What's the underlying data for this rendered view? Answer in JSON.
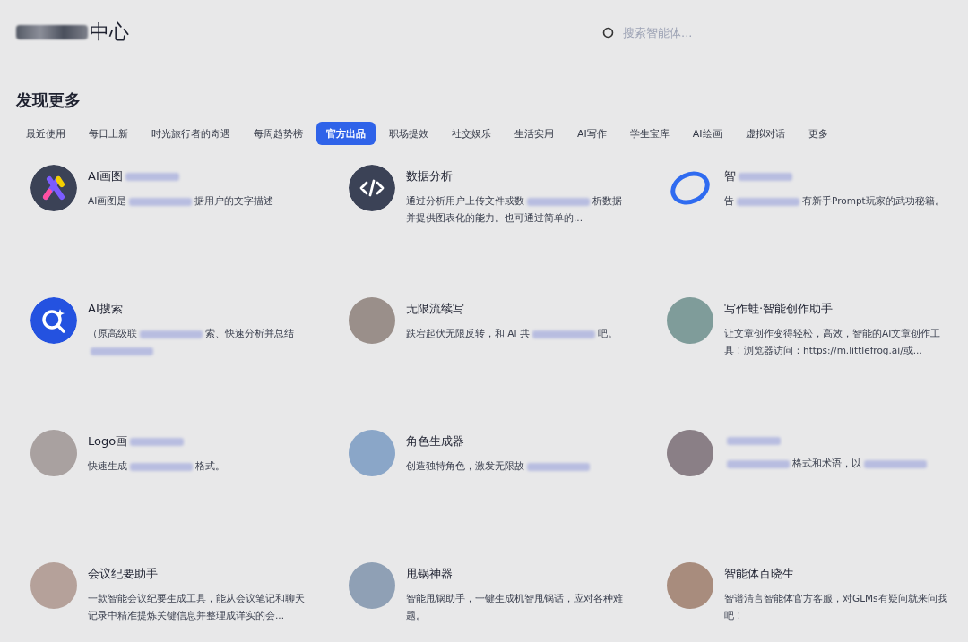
{
  "header": {
    "logo_suffix": "中心",
    "search": {
      "placeholder": "搜索智能体..."
    }
  },
  "section": {
    "title": "发现更多"
  },
  "tabs": [
    {
      "label": "最近使用",
      "selected": false
    },
    {
      "label": "每日上新",
      "selected": false
    },
    {
      "label": "时光旅行者的奇遇",
      "selected": false
    },
    {
      "label": "每周趋势榜",
      "selected": false
    },
    {
      "label": "官方出品",
      "selected": true
    },
    {
      "label": "职场提效",
      "selected": false
    },
    {
      "label": "社交娱乐",
      "selected": false
    },
    {
      "label": "生活实用",
      "selected": false
    },
    {
      "label": "AI写作",
      "selected": false
    },
    {
      "label": "学生宝库",
      "selected": false
    },
    {
      "label": "AI绘画",
      "selected": false
    },
    {
      "label": "虚拟对话",
      "selected": false
    },
    {
      "label": "更多",
      "selected": false
    }
  ],
  "agents": [
    {
      "kind": "logo",
      "title": [
        {
          "text": "AI画图"
        },
        {
          "kind": "redacted"
        }
      ],
      "description": [
        {
          "text": "AI画图是"
        },
        {
          "kind": "redacted"
        },
        {
          "text": "据用户的文字描述"
        }
      ]
    },
    {
      "kind": "code",
      "title": [
        {
          "text": "数据分析"
        }
      ],
      "description": [
        {
          "text": "通过分析用户上传文件或数"
        },
        {
          "kind": "redacted"
        },
        {
          "text": "析数据并提供图表化的能力。也可通过简单的..."
        }
      ]
    },
    {
      "kind": "ring",
      "title": [
        {
          "text": "智"
        },
        {
          "kind": "redacted"
        }
      ],
      "description": [
        {
          "text": "告"
        },
        {
          "kind": "redacted"
        },
        {
          "text": "有新手Prompt玩家的武功秘籍。"
        }
      ]
    },
    {
      "kind": "search",
      "title": [
        {
          "text": "AI搜索"
        }
      ],
      "description": [
        {
          "text": "（原高级联"
        },
        {
          "kind": "redacted"
        },
        {
          "text": "索、快速分析并总结"
        },
        {
          "kind": "redacted"
        }
      ]
    },
    {
      "kind": "photo",
      "title": [
        {
          "text": "无限流续写"
        }
      ],
      "description": [
        {
          "text": "跌宕起伏无限反转，和 AI 共"
        },
        {
          "kind": "redacted"
        },
        {
          "text": "吧。"
        }
      ]
    },
    {
      "kind": "photo",
      "title": [
        {
          "text": "写作蛙·智能创作助手"
        }
      ],
      "description": [
        {
          "text": "让文章创作变得轻松，高效，智能的AI文章创作工具！浏览器访问：https://m.littlefrog.ai/或..."
        }
      ]
    },
    {
      "kind": "photo",
      "title": [
        {
          "text": "Logo画"
        },
        {
          "kind": "redacted"
        }
      ],
      "description": [
        {
          "text": "快速生成"
        },
        {
          "kind": "redacted"
        },
        {
          "text": "格式。"
        }
      ]
    },
    {
      "kind": "photo",
      "title": [
        {
          "text": "角色生成器"
        }
      ],
      "description": [
        {
          "text": "创造独特角色，激发无限故"
        },
        {
          "kind": "redacted"
        }
      ]
    },
    {
      "kind": "photo",
      "title": [
        {
          "kind": "redacted"
        }
      ],
      "description": [
        {
          "kind": "redacted"
        },
        {
          "text": "格式和术语，以"
        },
        {
          "kind": "redacted"
        }
      ]
    },
    {
      "kind": "photo",
      "title": [
        {
          "text": "会议纪要助手"
        }
      ],
      "description": [
        {
          "text": "一款智能会议纪要生成工具，能从会议笔记和聊天记录中精准提炼关键信息并整理成详实的会..."
        }
      ]
    },
    {
      "kind": "photo",
      "title": [
        {
          "text": "甩锅神器"
        }
      ],
      "description": [
        {
          "text": "智能甩锅助手，一键生成机智甩锅话，应对各种难题。"
        }
      ]
    },
    {
      "kind": "photo",
      "title": [
        {
          "text": "智能体百晓生"
        }
      ],
      "description": [
        {
          "text": "智谱清言智能体官方客服，对GLMs有疑问就来问我吧！"
        }
      ]
    }
  ]
}
